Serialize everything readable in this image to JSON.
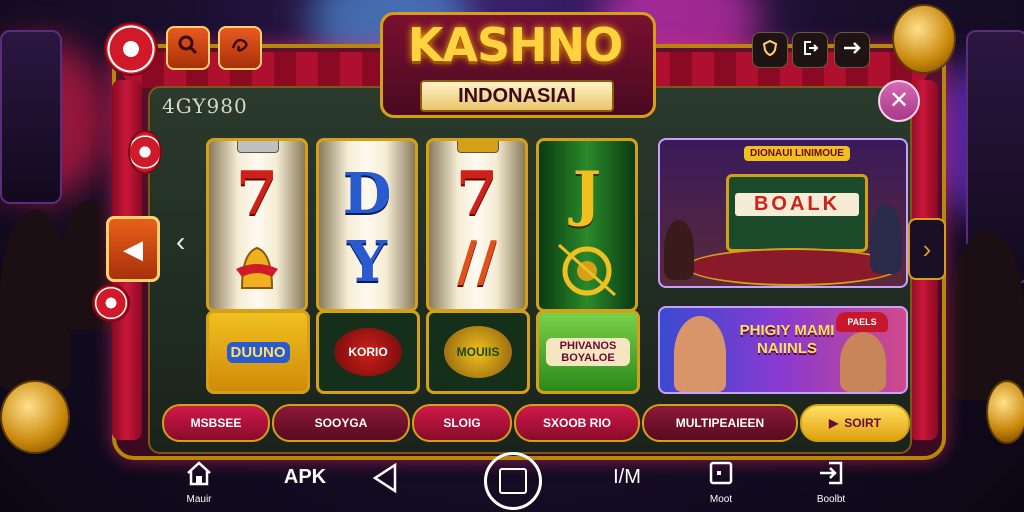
{
  "header": {
    "title": "KASHNO",
    "subtitle": "INDONASIAI",
    "score": "4GY980"
  },
  "top_left_icons": [
    {
      "icon": "search-icon"
    },
    {
      "icon": "swirl-icon"
    }
  ],
  "top_right_icons": [
    {
      "icon": "shield-icon"
    },
    {
      "icon": "exit-icon"
    },
    {
      "icon": "arrow-right-icon"
    }
  ],
  "reels": [
    {
      "top": "7",
      "bottom": "bell"
    },
    {
      "top": "D",
      "bottom": "Y"
    },
    {
      "top": "7",
      "bottom": "//"
    },
    {
      "top": "J",
      "bottom": "coin"
    }
  ],
  "symbol_tiles": [
    "DUUNO",
    "KORIO",
    "MOUIIS",
    "PHIVANOS BOYALOE"
  ],
  "promos": {
    "top_sign": "DIONAUI LINIMOUE",
    "top_slot": "BOALK",
    "bottom_text": "PHIGIY MAMI NAIINLS",
    "bottom_hat": "PAELS"
  },
  "tabs": [
    "MSBSEE",
    "SOOYGA",
    "SLOIG",
    "SXOOB RIO",
    "MULTIPEAIEEN",
    "SOIRT"
  ],
  "bottom_nav": [
    {
      "icon": "home-icon",
      "label": "Mauir"
    },
    {
      "icon": "",
      "label": "APK"
    },
    {
      "icon": "back-triangle-icon",
      "label": ""
    },
    {
      "icon": "center-button-icon",
      "label": ""
    },
    {
      "icon": "",
      "label": "I/M"
    },
    {
      "icon": "square-icon",
      "label": "Moot"
    },
    {
      "icon": "login-icon",
      "label": "Boolbt"
    }
  ],
  "colors": {
    "accent_gold": "#d4a017",
    "frame_red": "#5a1130",
    "panel_dark": "#1a231b",
    "title_yellow": "#ffd23f"
  }
}
